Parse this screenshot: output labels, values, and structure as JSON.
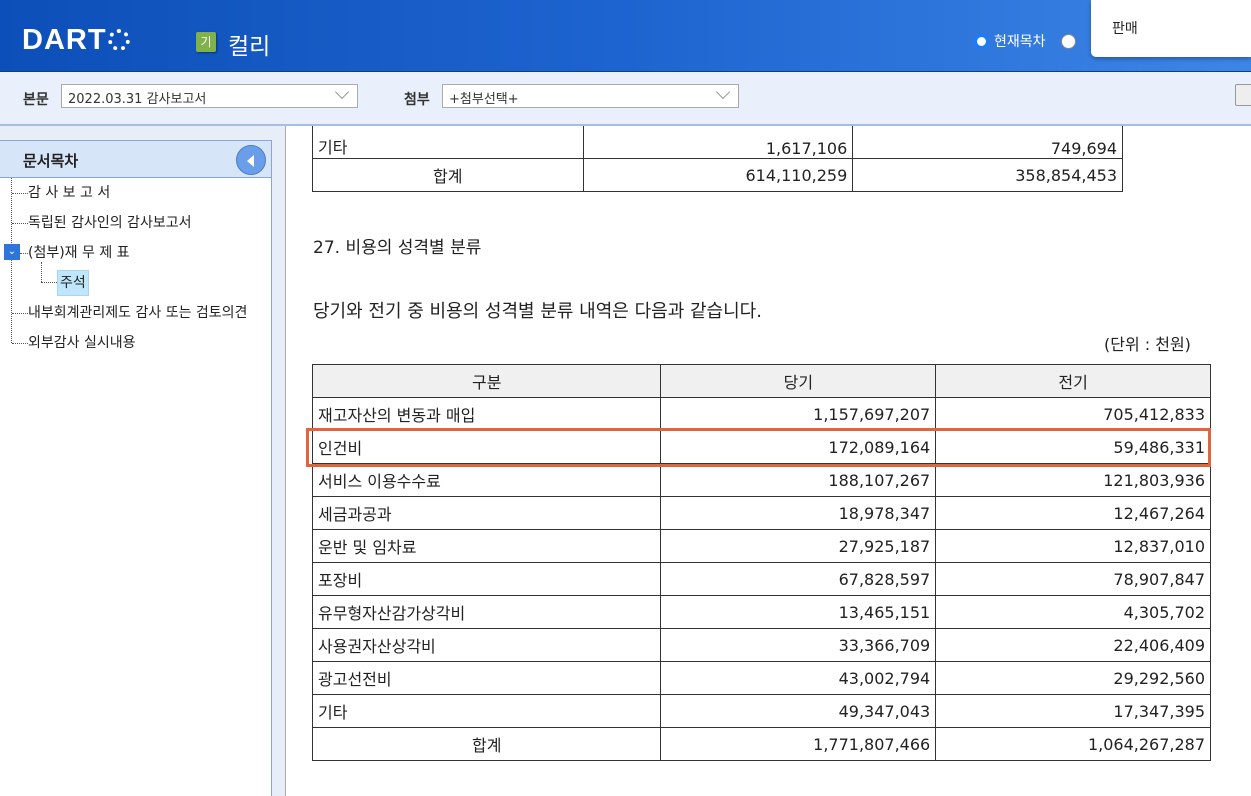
{
  "header": {
    "logo": "DART",
    "badge": "기",
    "company": "컬리",
    "radio_current": "현재목차",
    "popup_text": "판매"
  },
  "toolbar": {
    "main_label": "본문",
    "main_value": "2022.03.31  감사보고서",
    "attach_label": "첨부",
    "attach_value": "+첨부선택+"
  },
  "sidebar": {
    "title": "문서목차",
    "items": [
      {
        "label": "감 사 보 고 서"
      },
      {
        "label": "독립된 감사인의 감사보고서"
      },
      {
        "label": "(첨부)재 무 제 표"
      },
      {
        "label": "주석"
      },
      {
        "label": "내부회계관리제도 감사 또는 검토의견"
      },
      {
        "label": "외부감사 실시내용"
      }
    ]
  },
  "prev_table": {
    "rows": [
      [
        "기타",
        "1,617,106",
        "749,694"
      ],
      [
        "합계",
        "614,110,259",
        "358,854,453"
      ]
    ]
  },
  "section": {
    "title": "27. 비용의 성격별 분류",
    "desc": "당기와 전기 중 비용의 성격별 분류 내역은 다음과 같습니다.",
    "unit": "(단위 : 천원)"
  },
  "table": {
    "headers": [
      "구분",
      "당기",
      "전기"
    ],
    "rows": [
      [
        "재고자산의 변동과 매입",
        "1,157,697,207",
        "705,412,833"
      ],
      [
        "인건비",
        "172,089,164",
        "59,486,331"
      ],
      [
        "서비스 이용수수료",
        "188,107,267",
        "121,803,936"
      ],
      [
        "세금과공과",
        "18,978,347",
        "12,467,264"
      ],
      [
        "운반 및 임차료",
        "27,925,187",
        "12,837,010"
      ],
      [
        "포장비",
        "67,828,597",
        "78,907,847"
      ],
      [
        "유무형자산감가상각비",
        "13,465,151",
        "4,305,702"
      ],
      [
        "사용권자산상각비",
        "33,366,709",
        "22,406,409"
      ],
      [
        "광고선전비",
        "43,002,794",
        "29,292,560"
      ],
      [
        "기타",
        "49,347,043",
        "17,347,395"
      ]
    ],
    "total": [
      "합계",
      "1,771,807,466",
      "1,064,267,287"
    ]
  },
  "colors": {
    "highlight": "#e0643c",
    "header_blue": "#1e64d0"
  }
}
